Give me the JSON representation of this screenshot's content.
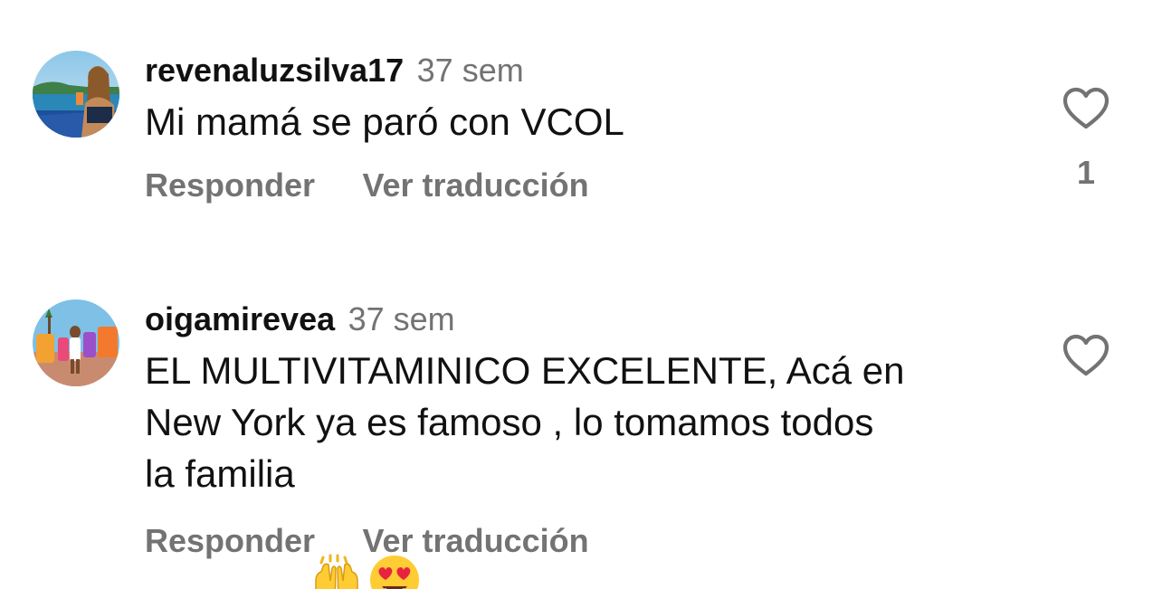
{
  "comments": [
    {
      "username": "revenaluzsilva17",
      "time": "37 sem",
      "text": "Mi mamá se paró con VCOL",
      "emojis": [],
      "reply_label": "Responder",
      "translate_label": "Ver traducción",
      "like_count": "1",
      "avatar_icon": "avatar-beach-photo"
    },
    {
      "username": "oigamirevea",
      "time": "37 sem",
      "text": "EL MULTIVITAMINICO EXCELENTE, Acá en\nNew York ya es famoso , lo tomamos todos\nla familia ",
      "emojis": [
        "raising-hands-emoji",
        "heart-eyes-emoji"
      ],
      "reply_label": "Responder",
      "translate_label": "Ver traducción",
      "like_count": "",
      "avatar_icon": "avatar-colorful-letters-photo"
    }
  ],
  "colors": {
    "text_primary": "#111111",
    "text_secondary": "#737373",
    "background": "#ffffff"
  }
}
